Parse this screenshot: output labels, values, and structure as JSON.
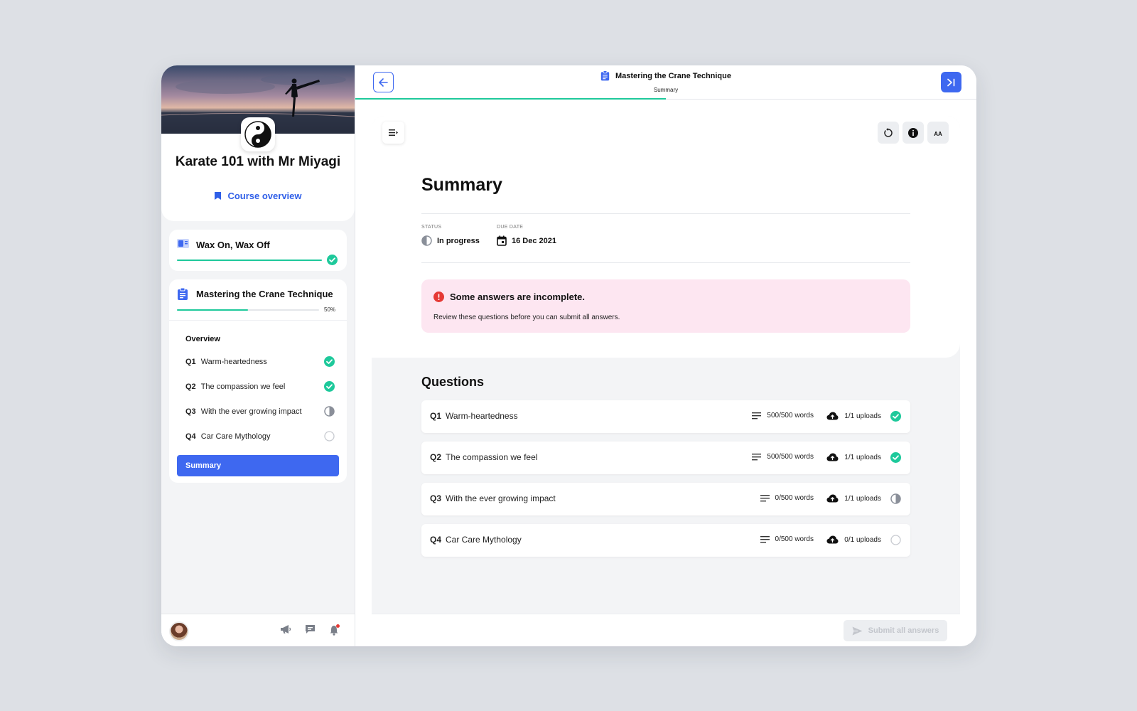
{
  "sidebar": {
    "course_title": "Karate 101 with Mr Miyagi",
    "course_overview_label": "Course overview",
    "modules": [
      {
        "title": "Wax On, Wax Off",
        "progress": 1.0,
        "status": "complete"
      },
      {
        "title": "Mastering the Crane Technique",
        "progress": 0.5,
        "progress_label": "50%"
      }
    ],
    "overview_label": "Overview",
    "questions": [
      {
        "number": "Q1",
        "title": "Warm-heartedness",
        "status": "complete"
      },
      {
        "number": "Q2",
        "title": "The compassion we feel",
        "status": "complete"
      },
      {
        "number": "Q3",
        "title": "With the ever growing impact",
        "status": "in-progress"
      },
      {
        "number": "Q4",
        "title": "Car Care Mythology",
        "status": "not-started"
      }
    ],
    "summary_label": "Summary",
    "footer_icons": [
      "megaphone-icon",
      "chat-icon",
      "bell-icon"
    ]
  },
  "topbar": {
    "title": "Mastering the Crane Technique",
    "subtitle": "Summary",
    "progress": 0.5
  },
  "main": {
    "heading": "Summary",
    "status_label": "STATUS",
    "status_value": "In progress",
    "due_label": "DUE DATE",
    "due_value": "16 Dec 2021",
    "alert_title": "Some answers are incomplete.",
    "alert_text": "Review these questions before you can submit all answers.",
    "questions_heading": "Questions",
    "questions": [
      {
        "number": "Q1",
        "title": "Warm-heartedness",
        "words": "500/500 words",
        "uploads": "1/1 uploads",
        "status": "complete"
      },
      {
        "number": "Q2",
        "title": "The compassion we feel",
        "words": "500/500 words",
        "uploads": "1/1 uploads",
        "status": "complete"
      },
      {
        "number": "Q3",
        "title": "With the ever growing impact",
        "words": "0/500 words",
        "uploads": "1/1 uploads",
        "status": "in-progress"
      },
      {
        "number": "Q4",
        "title": "Car Care Mythology",
        "words": "0/500 words",
        "uploads": "0/1 uploads",
        "status": "not-started"
      }
    ],
    "tools": {
      "font_size_label": "AA"
    },
    "submit_label": "Submit all answers"
  },
  "colors": {
    "accent": "#3e68f0",
    "success": "#1ec99b",
    "alert_bg": "#fde6f1",
    "alert_icon": "#e53935"
  }
}
